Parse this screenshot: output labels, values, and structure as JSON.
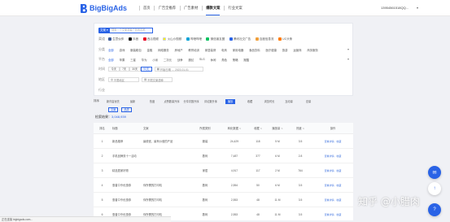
{
  "header": {
    "logo_text": "BigBigAds",
    "nav": [
      "首页",
      "广告全推荐",
      "广告素材",
      "爆款文案",
      "行业文案"
    ],
    "active_nav": 3,
    "account": "13954561518QQ...",
    "colors": {
      "brand": "#2a63e6",
      "accent_red": "#ea5a3c"
    }
  },
  "filters": {
    "search_select": "文案",
    "search_placeholder": "搜索一个文案或者广告商名称",
    "media_label": "渠道",
    "media": [
      {
        "icon": "facebook-icon",
        "label": "生意伙伴"
      },
      {
        "icon": "tiktok-icon",
        "label": "抖音"
      },
      {
        "icon": "pinterest-icon",
        "label": "西瓜视频"
      },
      {
        "icon": "snapchat-icon",
        "label": "火山小视频"
      },
      {
        "icon": "bilibili-icon",
        "label": "哔哩哔哩"
      },
      {
        "icon": "weixin-icon",
        "label": "微信朋友圈"
      },
      {
        "icon": "shared-icon",
        "label": "腾讯社交广告"
      },
      {
        "icon": "sohu-icon",
        "label": "百度信息流"
      },
      {
        "icon": "uc-icon",
        "label": "UC头条"
      }
    ],
    "category_label": "分类",
    "categories": [
      "全部",
      "游戏",
      "服装鞋包",
      "金融",
      "网络服务",
      "房地产",
      "教育培训",
      "家居装修",
      "电商",
      "家用电器",
      "食品饮料",
      "医疗健康",
      "旅游",
      "运营商",
      "商务服务",
      "母婴用品",
      "车辆"
    ],
    "platform_label": "平台",
    "platform_options": [
      "全部",
      "苹果",
      "三星",
      "华为",
      "小米",
      "二次元",
      "战争",
      "魔幻",
      "SLG",
      "休闲",
      "角色",
      "策略",
      "跑酷"
    ],
    "time_label": "时间",
    "time_options": [
      "今天",
      "7天",
      "30天",
      "90天"
    ],
    "date_placeholder": "开始日期 → 2023-01-01",
    "country_label": "地区",
    "country_value": "不限地区",
    "language_value": "不限文案语种",
    "type_label": "行业"
  },
  "sort": {
    "label": "排序",
    "options": [
      "新内容优先",
      "最新",
      "热度",
      "点赞数量升序",
      "分享次数升序",
      "评论数升序",
      "播放",
      "收藏",
      "浏览时长",
      "互动量",
      "总量"
    ],
    "active": 6
  },
  "chips": [
    "文案",
    "品类"
  ],
  "stats": {
    "prefix": "检索结果：",
    "count": "3,048,939"
  },
  "table": {
    "headers": [
      "排名",
      "标题",
      "文案",
      "所属类别",
      "转化数据",
      "收藏",
      "播放量",
      "热度",
      "操作"
    ],
    "rows": [
      {
        "rank": "1",
        "title": "新品推荐",
        "copy": "最便宜，最有价值的产品",
        "category": "服装",
        "metric1": "24,429",
        "metric2": "118",
        "metric3": "5 M",
        "metric4": "3.5",
        "action": "查看详情 · 收藏"
      },
      {
        "rank": "2",
        "title": "手机品牌双十一活动",
        "copy": "",
        "category": "数码",
        "metric1": "7,487",
        "metric2": "377",
        "metric3": "6 M",
        "metric4": "2.8",
        "action": "查看详情 · 收藏"
      },
      {
        "rank": "3",
        "title": "精选居家好物",
        "copy": "",
        "category": "家居",
        "metric1": "4,917",
        "metric2": "117",
        "metric3": "2 M",
        "metric4": "764",
        "action": "查看详情 · 收藏"
      },
      {
        "rank": "4",
        "title": "惠普口令优惠券",
        "copy": "你所需的打印机",
        "category": "数码",
        "metric1": "2,554",
        "metric2": "50",
        "metric3": "6 M",
        "metric4": "3.5",
        "action": "查看详情 · 收藏"
      },
      {
        "rank": "5",
        "title": "惠普口令优惠券",
        "copy": "你所需的打印机",
        "category": "数码",
        "metric1": "2,553",
        "metric2": "48",
        "metric3": "11 M",
        "metric4": "3.5",
        "action": "查看详情 · 收藏"
      },
      {
        "rank": "6",
        "title": "惠普口令优惠券",
        "copy": "你所需的打印机",
        "category": "数码",
        "metric1": "2,553",
        "metric2": "48",
        "metric3": "11 M",
        "metric4": "3.5",
        "action": "查看详情 · 收藏"
      }
    ]
  },
  "statusbar": "正在连接 bigbigads.com...",
  "watermark": "知乎 @小腊肉"
}
